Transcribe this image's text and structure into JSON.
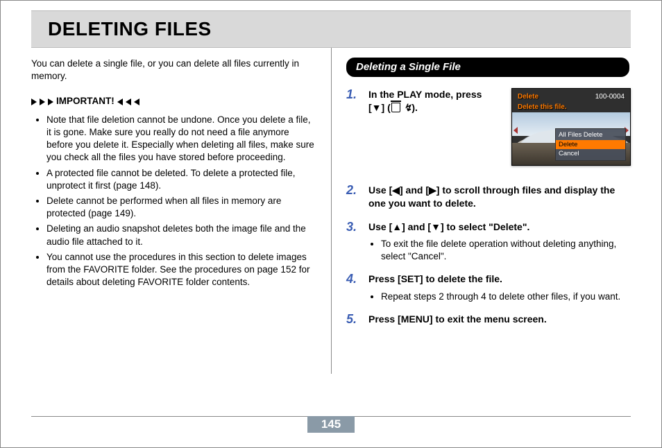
{
  "title": "DELETING FILES",
  "page_number": "145",
  "left": {
    "intro": "You can delete a single file, or you can delete all files currently in memory.",
    "important_label": "IMPORTANT!",
    "bullets": [
      "Note that file deletion cannot be undone. Once you delete a file, it is gone. Make sure you really do not need a file anymore before you delete it. Especially when deleting all files, make sure you check all the files you have stored before proceeding.",
      "A protected file cannot be deleted. To delete a protected file, unprotect it first (page 148).",
      "Delete cannot be performed when all files in memory are protected (page 149).",
      "Deleting an audio snapshot deletes both the image file and the audio file attached to it.",
      "You cannot use the procedures in this section to delete images from the FAVORITE folder. See the procedures on page 152 for details about deleting FAVORITE folder contents."
    ]
  },
  "right": {
    "section_title": "Deleting a Single File",
    "steps": [
      {
        "n": "1.",
        "text_pre": "In the PLAY mode, press [▼] (",
        "text_post": ")."
      },
      {
        "n": "2.",
        "text": "Use [◀] and [▶] to scroll through files and display the one you want to delete."
      },
      {
        "n": "3.",
        "text": "Use [▲] and [▼] to select \"Delete\".",
        "sub": [
          "To exit the file delete operation without deleting anything, select \"Cancel\"."
        ]
      },
      {
        "n": "4.",
        "text": "Press [SET] to delete the file.",
        "sub": [
          "Repeat steps 2 through 4 to delete other files, if you want."
        ]
      },
      {
        "n": "5.",
        "text": "Press [MENU] to exit the menu screen."
      }
    ],
    "lcd": {
      "title": "Delete",
      "file_no": "100-0004",
      "message": "Delete this file.",
      "menu": [
        "All Files Delete",
        "Delete",
        "Cancel"
      ],
      "selected_index": 1
    },
    "flash_glyph": "↯"
  }
}
